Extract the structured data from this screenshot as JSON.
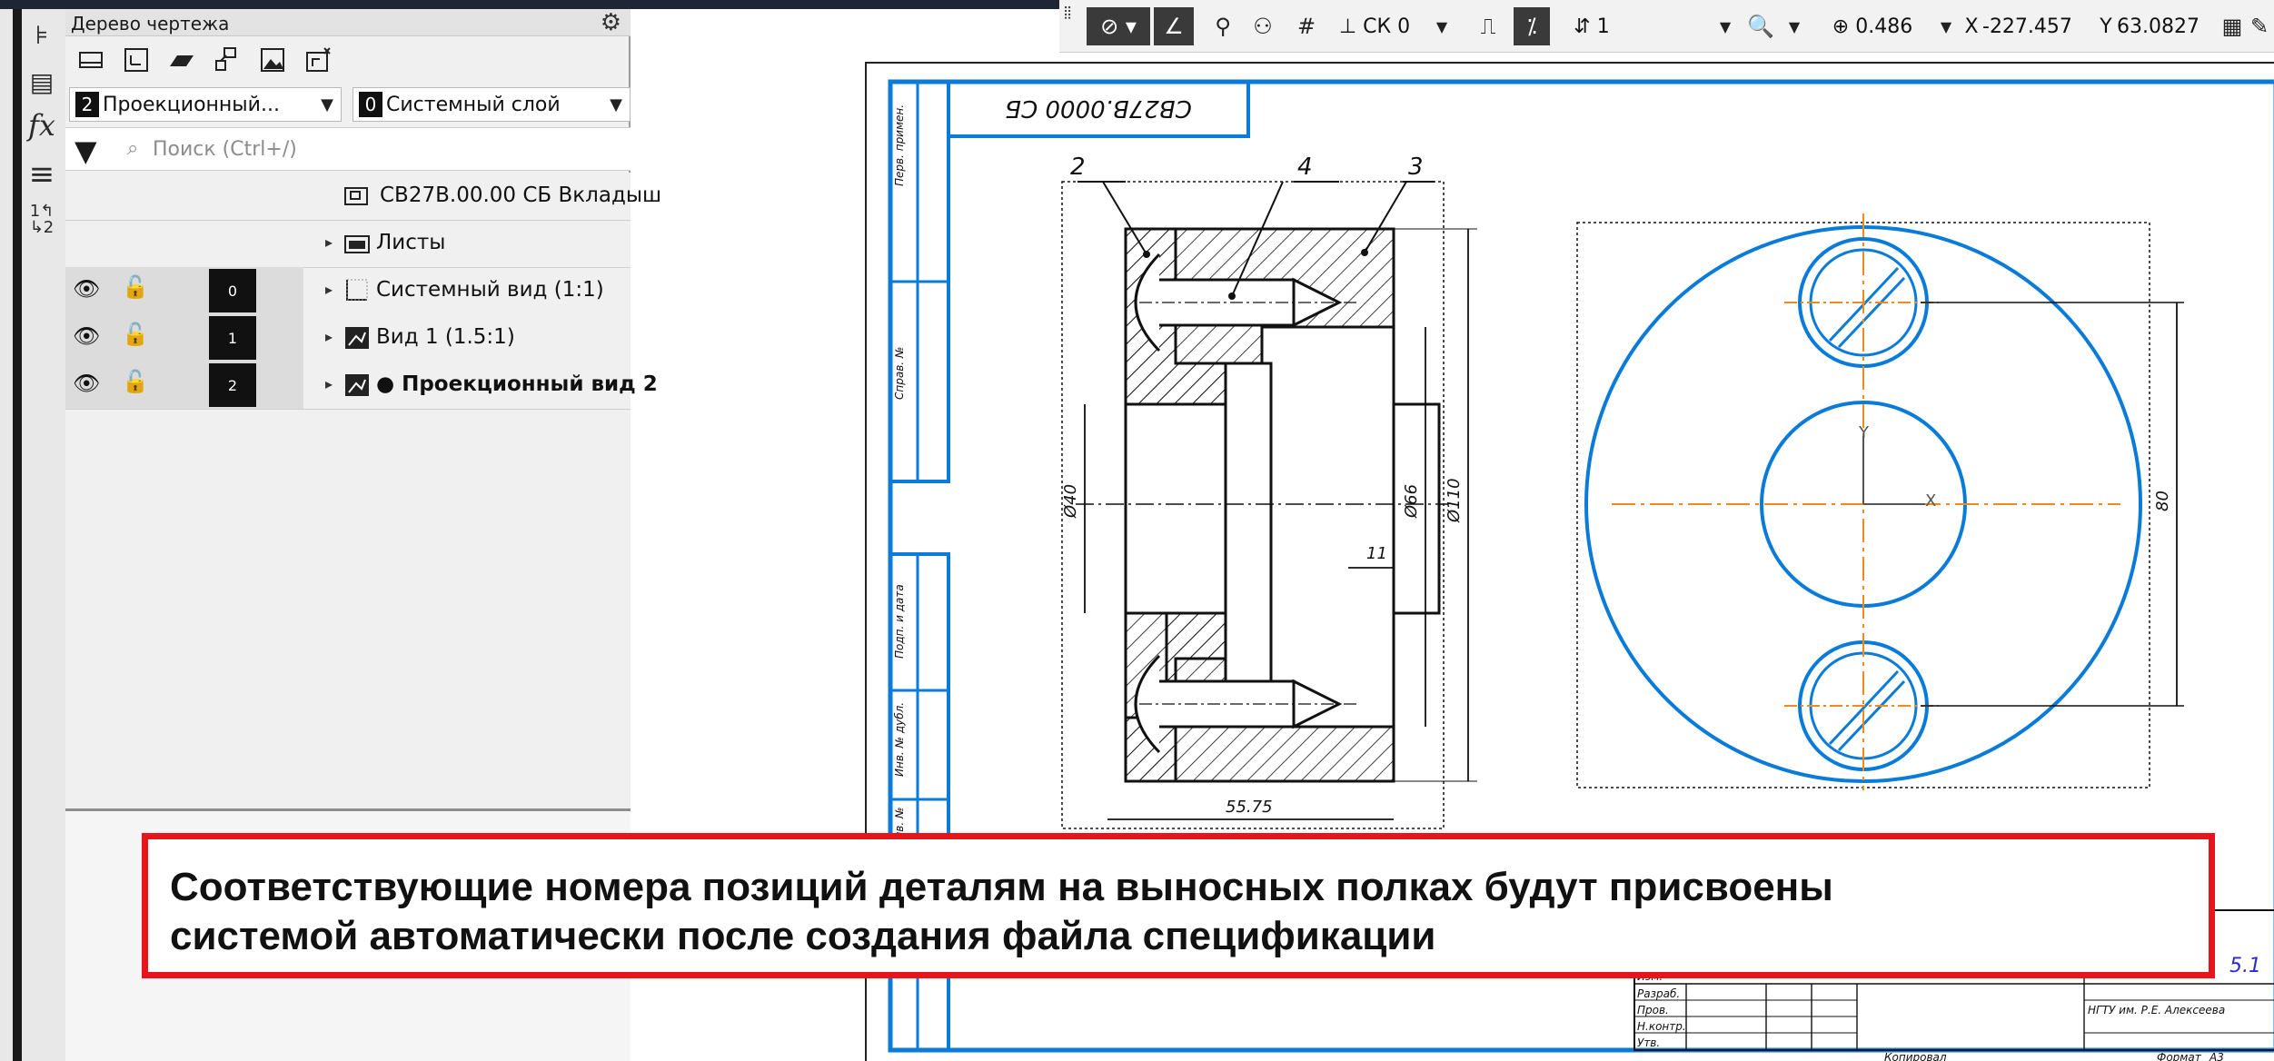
{
  "panel": {
    "title": "Дерево чертежа",
    "view_select": {
      "number": "2",
      "label": "Проекционный..."
    },
    "layer_select": {
      "number": "0",
      "label": "Системный слой"
    },
    "search_placeholder": "Поиск (Ctrl+/)",
    "root": {
      "label": "СВ27В.00.00 СБ Вкладыш"
    },
    "sheets": {
      "label": "Листы"
    },
    "views": [
      {
        "layer": "0",
        "label": "Системный вид (1:1)",
        "bold": false
      },
      {
        "layer": "1",
        "label": "Вид 1 (1.5:1)",
        "bold": false
      },
      {
        "layer": "2",
        "label": "● Проекционный вид 2",
        "bold": true
      }
    ]
  },
  "toolbar": {
    "coord_system": "СК 0",
    "step": "1",
    "zoom": "0.486",
    "x_label": "X",
    "x_value": "-227.457",
    "y_label": "Y",
    "y_value": "63.0827"
  },
  "drawing": {
    "designation_stamp": "СВ27В.0000 СБ",
    "position_labels": [
      "2",
      "4",
      "3"
    ],
    "dimensions": {
      "d40": "Ø40",
      "d66": "Ø66",
      "d110": "Ø110",
      "len11": "11",
      "len5575": "55.75",
      "len80": "80"
    },
    "axis_x": "X",
    "axis_y": "Y",
    "side_labels": [
      "Перв. примен.",
      "Справ. №",
      "Подп. и дата",
      "Инв. № дубл.",
      "Взам. инв. №"
    ],
    "title_block": {
      "approve": "Утв.",
      "norm": "Н.контр.",
      "litera": "Копировал",
      "format_label": "Формат",
      "format_value": "А3",
      "org": "НГТУ им. Р.Е. Алексеева",
      "sheet_num": "5.1",
      "rows": [
        "Изм.",
        "Разраб.",
        "Пров.",
        "Н.контр.",
        "Утв."
      ]
    }
  },
  "caption": {
    "line1": "Соответствующие номера позиций деталям на выносных полках будут присвоены",
    "line2": "системой автоматически после создания файла спецификации"
  }
}
